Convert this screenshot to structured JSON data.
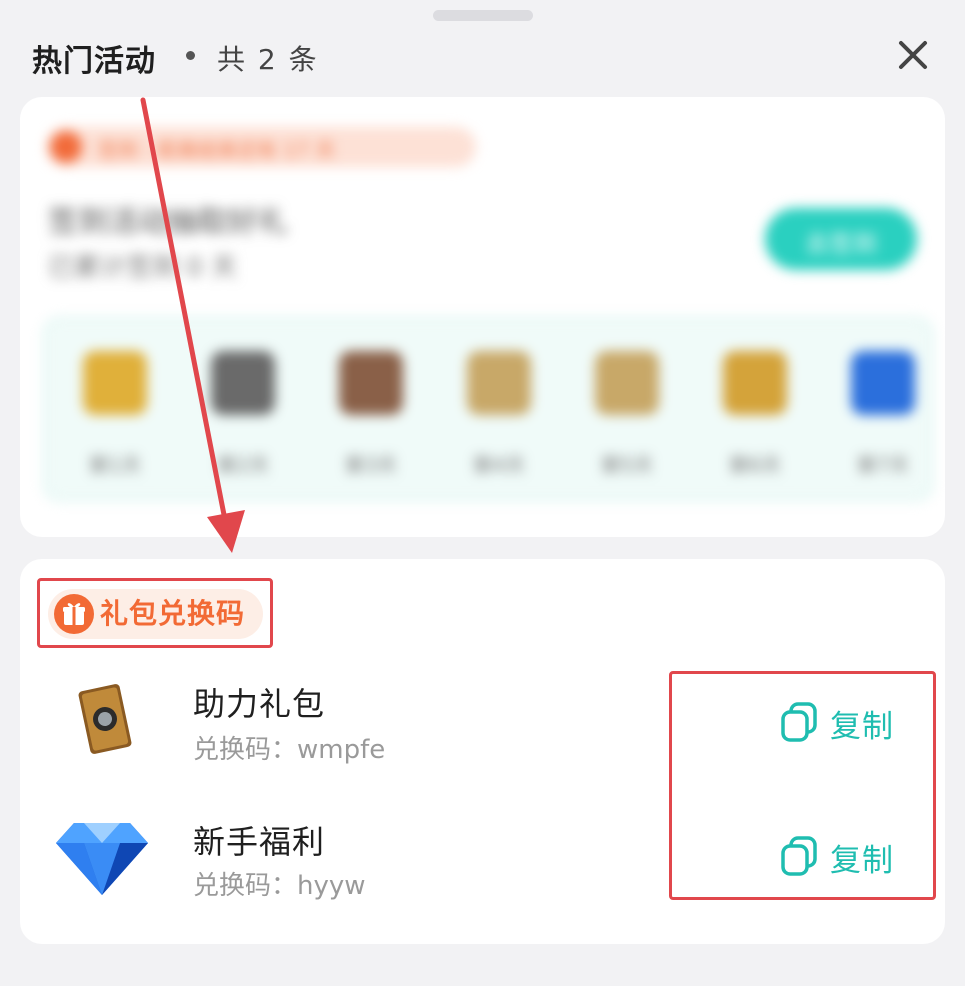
{
  "header": {
    "title": "热门活动",
    "count": "共 2 条"
  },
  "activity": {
    "badge": "签到 · 距离结束还有 17 天",
    "title": "签到活动抽取好礼",
    "subtitle": "已累计签到 0 天",
    "button": "去签到",
    "rewards": [
      {
        "label": "第1天",
        "icon": "gold-bag-icon",
        "color": "#e0b03a"
      },
      {
        "label": "第2天",
        "icon": "metal-ingot-icon",
        "color": "#6a6a6a"
      },
      {
        "label": "第3天",
        "icon": "scroll-icon",
        "color": "#8a6048"
      },
      {
        "label": "第4天",
        "icon": "key-icon",
        "color": "#c8a868"
      },
      {
        "label": "第5天",
        "icon": "key-icon",
        "color": "#c8a868"
      },
      {
        "label": "第6天",
        "icon": "treasure-chest-icon",
        "color": "#d4a33a"
      },
      {
        "label": "第7天",
        "icon": "diamond-icon",
        "color": "#2b6fdc"
      }
    ]
  },
  "giftcodes": {
    "tag": "礼包兑换码",
    "items": [
      {
        "name": "助力礼包",
        "code": "兑换码：wmpfe",
        "copy": "复制"
      },
      {
        "name": "新手福利",
        "code": "兑换码：hyyw",
        "copy": "复制"
      }
    ]
  },
  "colors": {
    "accent": "#1fbdb0",
    "orange": "#f26a35",
    "highlight": "#e1474c"
  }
}
